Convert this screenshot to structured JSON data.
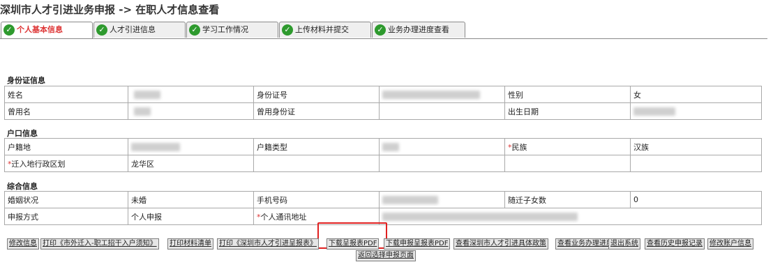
{
  "page": {
    "title": "深圳市人才引进业务申报 -> 在职人才信息查看"
  },
  "tabs": [
    {
      "label": "个人基本信息",
      "active": true
    },
    {
      "label": "人才引进信息",
      "active": false
    },
    {
      "label": "学习工作情况",
      "active": false
    },
    {
      "label": "上传材料并提交",
      "active": false
    },
    {
      "label": "业务办理进度查看",
      "active": false
    }
  ],
  "identity": {
    "section_title": "身份证信息",
    "name_label": "姓名",
    "id_label": "身份证号",
    "gender_label": "性别",
    "gender_value": "女",
    "former_name_label": "曾用名",
    "former_id_label": "曾用身份证",
    "birth_label": "出生日期"
  },
  "household": {
    "section_title": "户口信息",
    "hukou_label": "户籍地",
    "hukou_type_label": "户籍类型",
    "ethnicity_label": "民族",
    "ethnicity_value": "汉族",
    "move_in_label": "迁入地行政区划",
    "move_in_value": "龙华区"
  },
  "other": {
    "section_title": "综合信息",
    "marital_label": "婚姻状况",
    "marital_value": "未婚",
    "phone_label": "手机号码",
    "children_label": "随迁子女数",
    "children_value": "0",
    "apply_method_label": "申报方式",
    "apply_method_value": "个人申报",
    "address_label": "个人通讯地址"
  },
  "actions": [
    "修改信息",
    "打印《市外迁入-职工招干入户须知》",
    "打印材料清单",
    "打印《深圳市人才引进呈报表》",
    "下载呈报表PDF",
    "下载申报呈报表PDF",
    "查看深圳市人才引进具体政策",
    "查看业务办理进度",
    "退出系统",
    "查看历史申报记录",
    "修改账户信息"
  ],
  "action_row2": "返回选择申报页面",
  "colors": {
    "check_green": "#2e9a2e",
    "active_tab_text": "#d33333",
    "highlight_border": "#e02020"
  }
}
